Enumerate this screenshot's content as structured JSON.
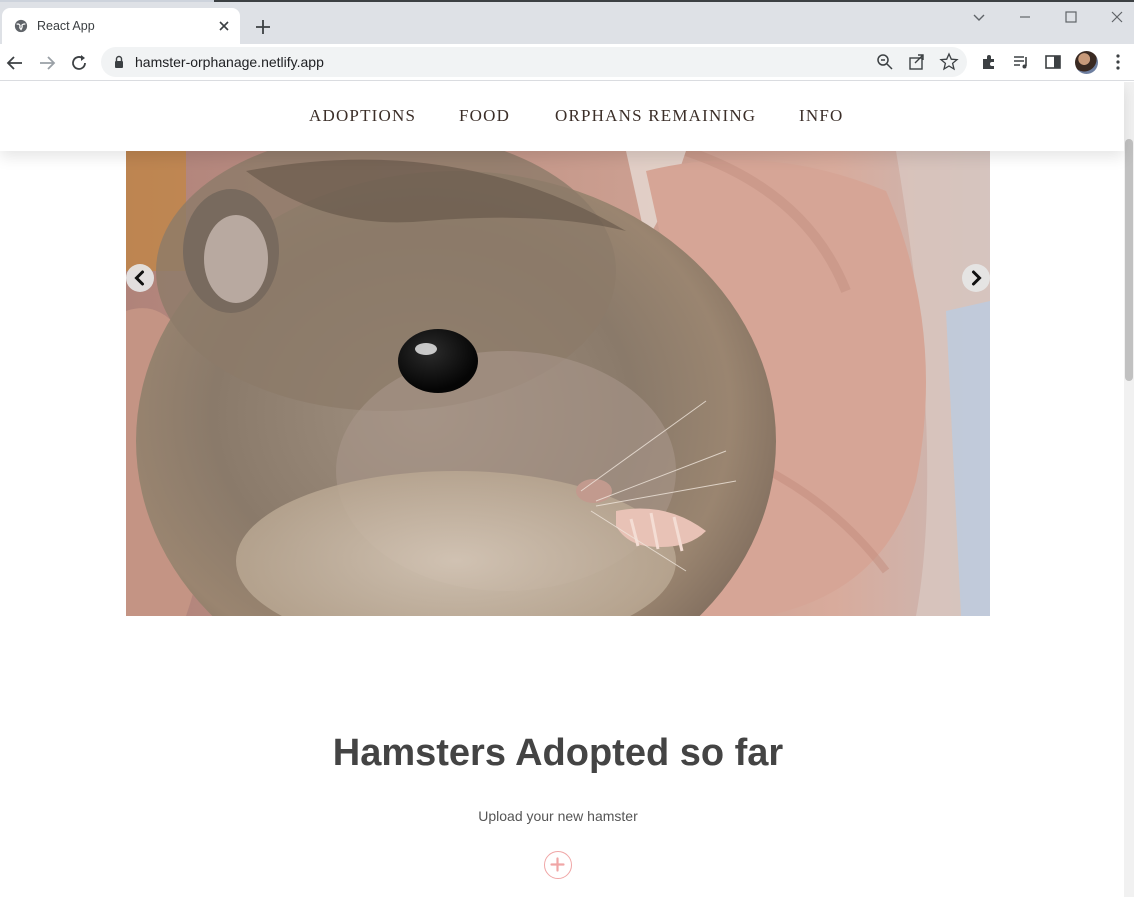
{
  "browser": {
    "tab_title": "React App",
    "url": "hamster-orphanage.netlify.app"
  },
  "nav": {
    "items": [
      {
        "label": "ADOPTIONS"
      },
      {
        "label": "FOOD"
      },
      {
        "label": "ORPHANS REMAINING"
      },
      {
        "label": "INFO"
      }
    ]
  },
  "carousel": {
    "image": "hamster-photo",
    "prev_icon": "chevron-left-icon",
    "next_icon": "chevron-right-icon"
  },
  "main": {
    "heading": "Hamsters Adopted so far",
    "upload_label": "Upload your new hamster",
    "upload_icon": "plus-circle-icon"
  },
  "colors": {
    "nav_text": "#3b2e28",
    "heading": "#444444",
    "accent_pink": "#f0a6a6"
  }
}
